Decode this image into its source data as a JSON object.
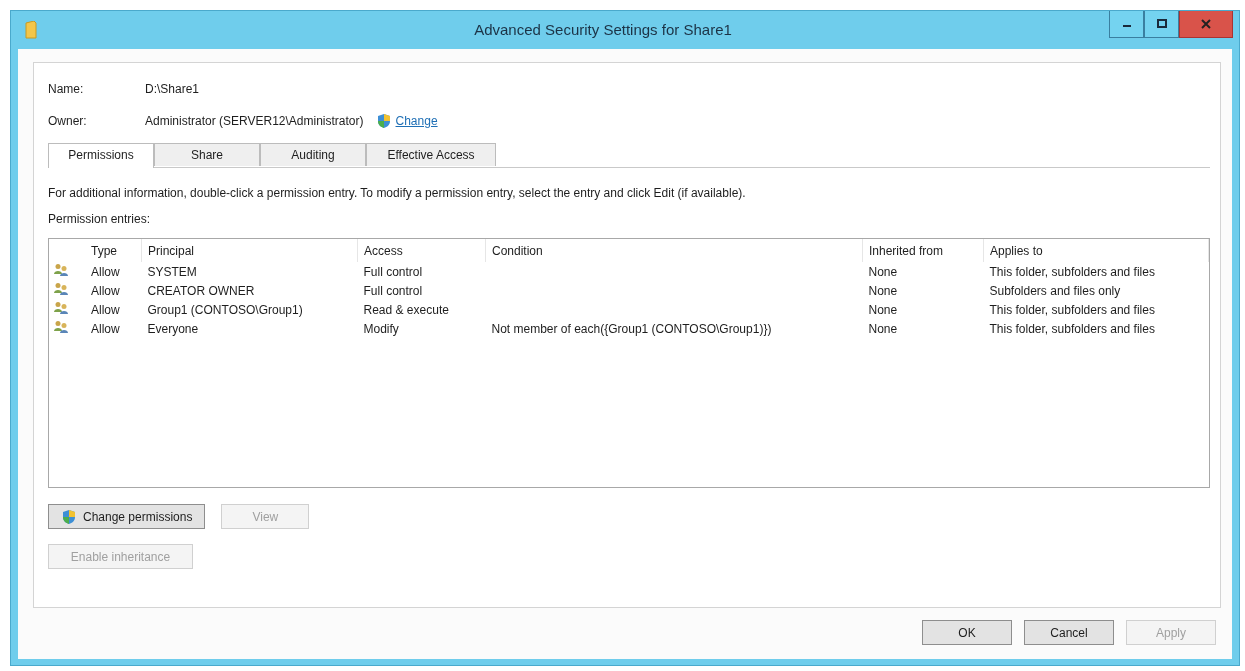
{
  "window": {
    "title": "Advanced Security Settings for Share1"
  },
  "info": [
    {
      "label": "Name:",
      "value": "D:\\Share1"
    },
    {
      "label": "Owner:",
      "value": "Administrator (SERVER12\\Administrator)",
      "link": "Change"
    }
  ],
  "tabs": [
    {
      "label": "Permissions",
      "selected": true
    },
    {
      "label": "Share",
      "selected": false
    },
    {
      "label": "Auditing",
      "selected": false
    },
    {
      "label": "Effective Access",
      "selected": false
    }
  ],
  "description": "For additional information, double-click a permission entry. To modify a permission entry, select the entry and click Edit (if available).",
  "entries_label": "Permission entries:",
  "table": {
    "columns": [
      "Type",
      "Principal",
      "Access",
      "Condition",
      "Inherited from",
      "Applies to"
    ],
    "rows": [
      {
        "cells": [
          "Allow",
          "SYSTEM",
          "Full control",
          "",
          "None",
          "This folder, subfolders and files"
        ]
      },
      {
        "cells": [
          "Allow",
          "CREATOR OWNER",
          "Full control",
          "",
          "None",
          "Subfolders and files only"
        ]
      },
      {
        "cells": [
          "Allow",
          "Group1 (CONTOSO\\Group1)",
          "Read & execute",
          "",
          "None",
          "This folder, subfolders and files"
        ]
      },
      {
        "cells": [
          "Allow",
          "Everyone",
          "Modify",
          "Not member of each({Group1 (CONTOSO\\Group1)})",
          "None",
          "This folder, subfolders and files"
        ]
      }
    ]
  },
  "actions": [
    {
      "label": "Change permissions",
      "shield": true,
      "disabled": false
    },
    {
      "label": "View",
      "shield": false,
      "disabled": true
    }
  ],
  "inheritance_button": {
    "label": "Enable inheritance",
    "disabled": true
  },
  "buttons": [
    {
      "label": "OK",
      "disabled": false
    },
    {
      "label": "Cancel",
      "disabled": false
    },
    {
      "label": "Apply",
      "disabled": true
    }
  ]
}
